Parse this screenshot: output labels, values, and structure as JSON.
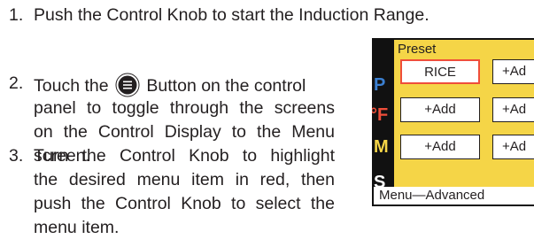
{
  "instructions": {
    "step1": {
      "number": "1.",
      "text": "Push the Control Knob to start the Induction Range."
    },
    "step2": {
      "number": "2.",
      "line1_before": "Touch the",
      "line1_after": "Button on the control",
      "line2": "panel to toggle through the screens",
      "line3": "on the Control Display to the Menu",
      "line4": "screen.",
      "icon": "menu-button-icon"
    },
    "step3": {
      "number": "3.",
      "line1": "Turn the Control Knob to highlight",
      "line2": "the desired menu item in red, then",
      "line3": "push the Control Knob to select the",
      "line4": "menu item."
    }
  },
  "display": {
    "screen_color": "#f5d547",
    "frame_color": "#111111",
    "side_tabs": [
      {
        "label": "P",
        "color": "#3b7fd1"
      },
      {
        "label": "°F",
        "color": "#ef4e3a"
      },
      {
        "label": "M",
        "color": "#f5d547"
      },
      {
        "label": "S",
        "color": "#ffffff"
      }
    ],
    "header": "Preset",
    "items": [
      {
        "label": "RICE",
        "selected": true
      },
      {
        "label": "+Ad",
        "selected": false
      },
      {
        "label": "+Add",
        "selected": false
      },
      {
        "label": "+Ad",
        "selected": false
      },
      {
        "label": "+Add",
        "selected": false
      },
      {
        "label": "+Ad",
        "selected": false
      }
    ],
    "selected_color": "#ef4e3a",
    "caption": "Menu—Advanced"
  }
}
